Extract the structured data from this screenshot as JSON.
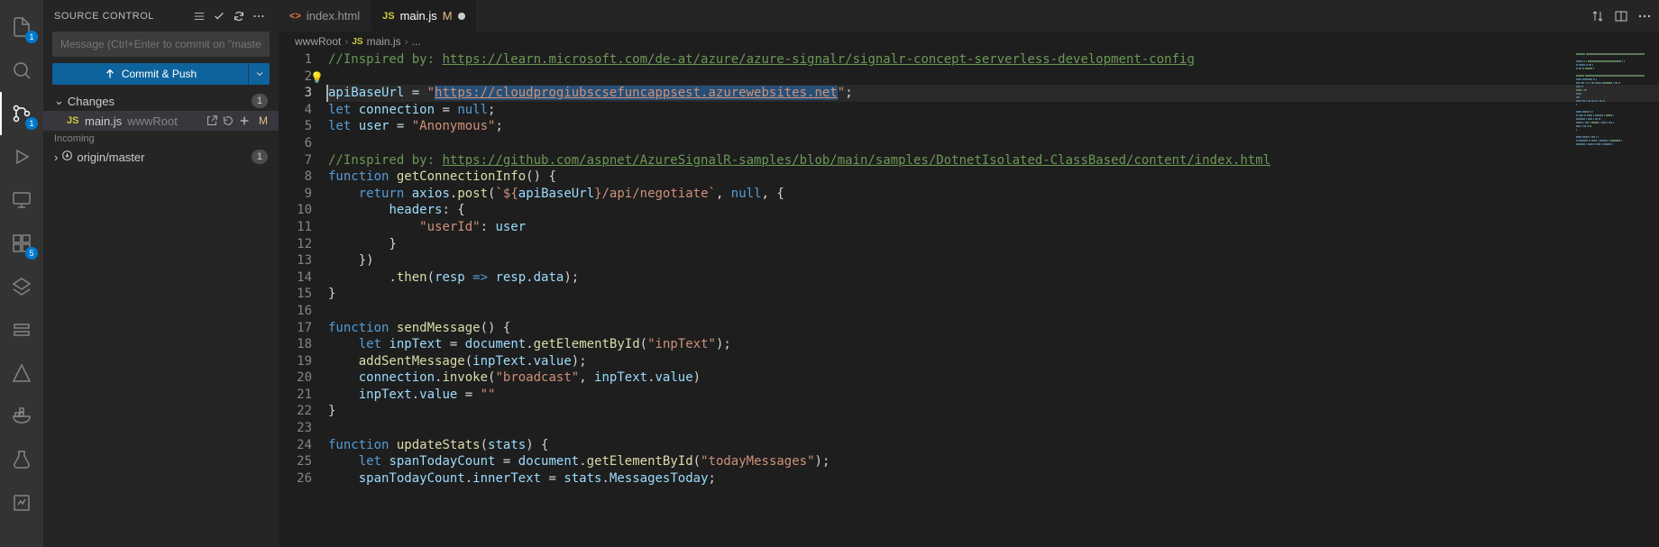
{
  "scm": {
    "title": "SOURCE CONTROL",
    "message_placeholder": "Message (Ctrl+Enter to commit on \"master\")",
    "commit_button": "Commit & Push",
    "changes_label": "Changes",
    "changes_count": "1",
    "file": {
      "name": "main.js",
      "location": "wwwRoot",
      "modified_letter": "M"
    },
    "incoming_label": "Incoming",
    "branch_label": "origin/master",
    "branch_count": "1"
  },
  "activity_badges": {
    "explorer": "1",
    "scm": "1",
    "extensions": "5"
  },
  "tabs": {
    "items": [
      {
        "icon": "<>",
        "label": "index.html"
      },
      {
        "icon": "JS",
        "label": "main.js",
        "modified": "M"
      }
    ]
  },
  "breadcrumbs": [
    "wwwRoot",
    "main.js",
    "..."
  ],
  "code": {
    "lines": [
      {
        "n": 1,
        "tokens": [
          {
            "t": "//Inspired by: ",
            "c": "cm"
          },
          {
            "t": "https://learn.microsoft.com/de-at/azure/azure-signalr/signalr-concept-serverless-development-config",
            "c": "lnk"
          }
        ]
      },
      {
        "n": 2,
        "tokens": [],
        "bulb": true
      },
      {
        "n": 3,
        "cur": true,
        "tokens": [
          {
            "t": "apiBaseUrl",
            "c": "vr"
          },
          {
            "t": " = ",
            "c": "op"
          },
          {
            "t": "\"",
            "c": "str"
          },
          {
            "t": "https://cloudprogiubscsefuncappsest.azurewebsites.net",
            "c": "str",
            "sel": true,
            "ul": true
          },
          {
            "t": "\"",
            "c": "str"
          },
          {
            "t": ";",
            "c": "op"
          }
        ]
      },
      {
        "n": 4,
        "tokens": [
          {
            "t": "let",
            "c": "kw"
          },
          {
            "t": " ",
            "c": ""
          },
          {
            "t": "connection",
            "c": "vr"
          },
          {
            "t": " = ",
            "c": "op"
          },
          {
            "t": "null",
            "c": "kw"
          },
          {
            "t": ";",
            "c": "op"
          }
        ]
      },
      {
        "n": 5,
        "tokens": [
          {
            "t": "let",
            "c": "kw"
          },
          {
            "t": " ",
            "c": ""
          },
          {
            "t": "user",
            "c": "vr"
          },
          {
            "t": " = ",
            "c": "op"
          },
          {
            "t": "\"Anonymous\"",
            "c": "str"
          },
          {
            "t": ";",
            "c": "op"
          }
        ]
      },
      {
        "n": 6,
        "tokens": []
      },
      {
        "n": 7,
        "tokens": [
          {
            "t": "//Inspired by: ",
            "c": "cm"
          },
          {
            "t": "https://github.com/aspnet/AzureSignalR-samples/blob/main/samples/DotnetIsolated-ClassBased/content/index.html",
            "c": "lnk"
          }
        ]
      },
      {
        "n": 8,
        "tokens": [
          {
            "t": "function",
            "c": "kw"
          },
          {
            "t": " ",
            "c": ""
          },
          {
            "t": "getConnectionInfo",
            "c": "fn"
          },
          {
            "t": "()",
            "c": "br"
          },
          {
            "t": " {",
            "c": "br"
          }
        ]
      },
      {
        "n": 9,
        "tokens": [
          {
            "t": "    ",
            "c": ""
          },
          {
            "t": "return",
            "c": "kw"
          },
          {
            "t": " ",
            "c": ""
          },
          {
            "t": "axios",
            "c": "vr"
          },
          {
            "t": ".",
            "c": "op"
          },
          {
            "t": "post",
            "c": "fn"
          },
          {
            "t": "(",
            "c": "br"
          },
          {
            "t": "`${",
            "c": "str"
          },
          {
            "t": "apiBaseUrl",
            "c": "vr"
          },
          {
            "t": "}/api/negotiate`",
            "c": "str"
          },
          {
            "t": ", ",
            "c": "op"
          },
          {
            "t": "null",
            "c": "kw"
          },
          {
            "t": ", {",
            "c": "br"
          }
        ]
      },
      {
        "n": 10,
        "tokens": [
          {
            "t": "        ",
            "c": ""
          },
          {
            "t": "headers",
            "c": "vr"
          },
          {
            "t": ": {",
            "c": "br"
          }
        ]
      },
      {
        "n": 11,
        "tokens": [
          {
            "t": "            ",
            "c": ""
          },
          {
            "t": "\"userId\"",
            "c": "str"
          },
          {
            "t": ": ",
            "c": "op"
          },
          {
            "t": "user",
            "c": "vr"
          }
        ]
      },
      {
        "n": 12,
        "tokens": [
          {
            "t": "        }",
            "c": "br"
          }
        ]
      },
      {
        "n": 13,
        "tokens": [
          {
            "t": "    })",
            "c": "br"
          }
        ]
      },
      {
        "n": 14,
        "tokens": [
          {
            "t": "        .",
            "c": "op"
          },
          {
            "t": "then",
            "c": "fn"
          },
          {
            "t": "(",
            "c": "br"
          },
          {
            "t": "resp",
            "c": "vr"
          },
          {
            "t": " => ",
            "c": "kw"
          },
          {
            "t": "resp",
            "c": "vr"
          },
          {
            "t": ".",
            "c": "op"
          },
          {
            "t": "data",
            "c": "vr"
          },
          {
            "t": ");",
            "c": "br"
          }
        ]
      },
      {
        "n": 15,
        "tokens": [
          {
            "t": "}",
            "c": "br"
          }
        ]
      },
      {
        "n": 16,
        "tokens": []
      },
      {
        "n": 17,
        "tokens": [
          {
            "t": "function",
            "c": "kw"
          },
          {
            "t": " ",
            "c": ""
          },
          {
            "t": "sendMessage",
            "c": "fn"
          },
          {
            "t": "()",
            "c": "br"
          },
          {
            "t": " {",
            "c": "br"
          }
        ]
      },
      {
        "n": 18,
        "tokens": [
          {
            "t": "    ",
            "c": ""
          },
          {
            "t": "let",
            "c": "kw"
          },
          {
            "t": " ",
            "c": ""
          },
          {
            "t": "inpText",
            "c": "vr"
          },
          {
            "t": " = ",
            "c": "op"
          },
          {
            "t": "document",
            "c": "vr"
          },
          {
            "t": ".",
            "c": "op"
          },
          {
            "t": "getElementById",
            "c": "fn"
          },
          {
            "t": "(",
            "c": "br"
          },
          {
            "t": "\"inpText\"",
            "c": "str"
          },
          {
            "t": ");",
            "c": "br"
          }
        ]
      },
      {
        "n": 19,
        "tokens": [
          {
            "t": "    ",
            "c": ""
          },
          {
            "t": "addSentMessage",
            "c": "fn"
          },
          {
            "t": "(",
            "c": "br"
          },
          {
            "t": "inpText",
            "c": "vr"
          },
          {
            "t": ".",
            "c": "op"
          },
          {
            "t": "value",
            "c": "vr"
          },
          {
            "t": ");",
            "c": "br"
          }
        ]
      },
      {
        "n": 20,
        "tokens": [
          {
            "t": "    ",
            "c": ""
          },
          {
            "t": "connection",
            "c": "vr"
          },
          {
            "t": ".",
            "c": "op"
          },
          {
            "t": "invoke",
            "c": "fn"
          },
          {
            "t": "(",
            "c": "br"
          },
          {
            "t": "\"broadcast\"",
            "c": "str"
          },
          {
            "t": ", ",
            "c": "op"
          },
          {
            "t": "inpText",
            "c": "vr"
          },
          {
            "t": ".",
            "c": "op"
          },
          {
            "t": "value",
            "c": "vr"
          },
          {
            "t": ")",
            "c": "br"
          }
        ]
      },
      {
        "n": 21,
        "tokens": [
          {
            "t": "    ",
            "c": ""
          },
          {
            "t": "inpText",
            "c": "vr"
          },
          {
            "t": ".",
            "c": "op"
          },
          {
            "t": "value",
            "c": "vr"
          },
          {
            "t": " = ",
            "c": "op"
          },
          {
            "t": "\"\"",
            "c": "str"
          }
        ]
      },
      {
        "n": 22,
        "tokens": [
          {
            "t": "}",
            "c": "br"
          }
        ]
      },
      {
        "n": 23,
        "tokens": []
      },
      {
        "n": 24,
        "tokens": [
          {
            "t": "function",
            "c": "kw"
          },
          {
            "t": " ",
            "c": ""
          },
          {
            "t": "updateStats",
            "c": "fn"
          },
          {
            "t": "(",
            "c": "br"
          },
          {
            "t": "stats",
            "c": "vr"
          },
          {
            "t": ")",
            "c": "br"
          },
          {
            "t": " {",
            "c": "br"
          }
        ]
      },
      {
        "n": 25,
        "tokens": [
          {
            "t": "    ",
            "c": ""
          },
          {
            "t": "let",
            "c": "kw"
          },
          {
            "t": " ",
            "c": ""
          },
          {
            "t": "spanTodayCount",
            "c": "vr"
          },
          {
            "t": " = ",
            "c": "op"
          },
          {
            "t": "document",
            "c": "vr"
          },
          {
            "t": ".",
            "c": "op"
          },
          {
            "t": "getElementById",
            "c": "fn"
          },
          {
            "t": "(",
            "c": "br"
          },
          {
            "t": "\"todayMessages\"",
            "c": "str"
          },
          {
            "t": ");",
            "c": "br"
          }
        ]
      },
      {
        "n": 26,
        "tokens": [
          {
            "t": "    ",
            "c": ""
          },
          {
            "t": "spanTodayCount",
            "c": "vr"
          },
          {
            "t": ".",
            "c": "op"
          },
          {
            "t": "innerText",
            "c": "vr"
          },
          {
            "t": " = ",
            "c": "op"
          },
          {
            "t": "stats",
            "c": "vr"
          },
          {
            "t": ".",
            "c": "op"
          },
          {
            "t": "MessagesToday",
            "c": "vr"
          },
          {
            "t": ";",
            "c": "op"
          }
        ]
      }
    ]
  }
}
